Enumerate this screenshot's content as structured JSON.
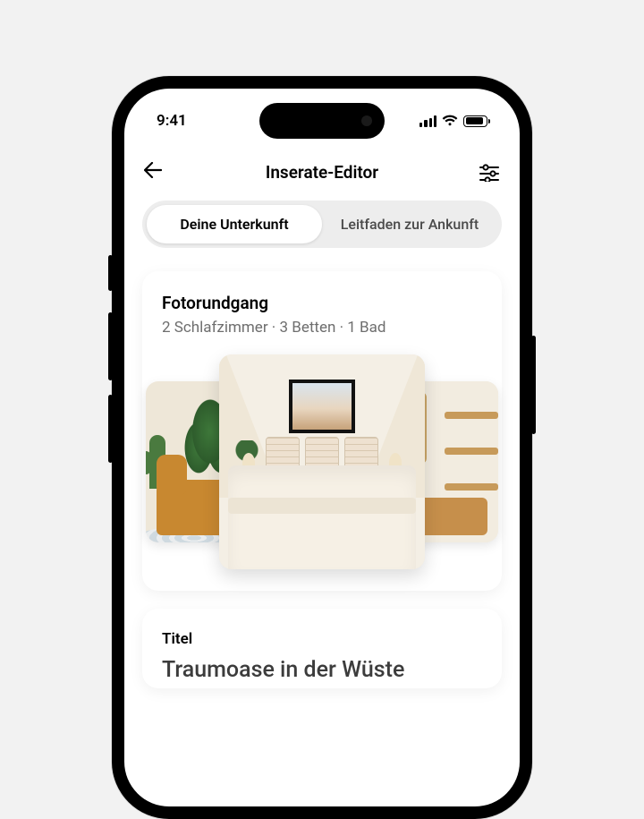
{
  "status": {
    "time": "9:41"
  },
  "nav": {
    "title": "Inserate-Editor"
  },
  "tabs": {
    "active": "Deine Unterkunft",
    "inactive": "Leitfaden zur Ankunft"
  },
  "photoTour": {
    "label": "Fotorundgang",
    "meta": "2 Schlafzimmer · 3 Betten · 1 Bad"
  },
  "title": {
    "label": "Titel",
    "value": "Traumoase in der Wüste"
  }
}
